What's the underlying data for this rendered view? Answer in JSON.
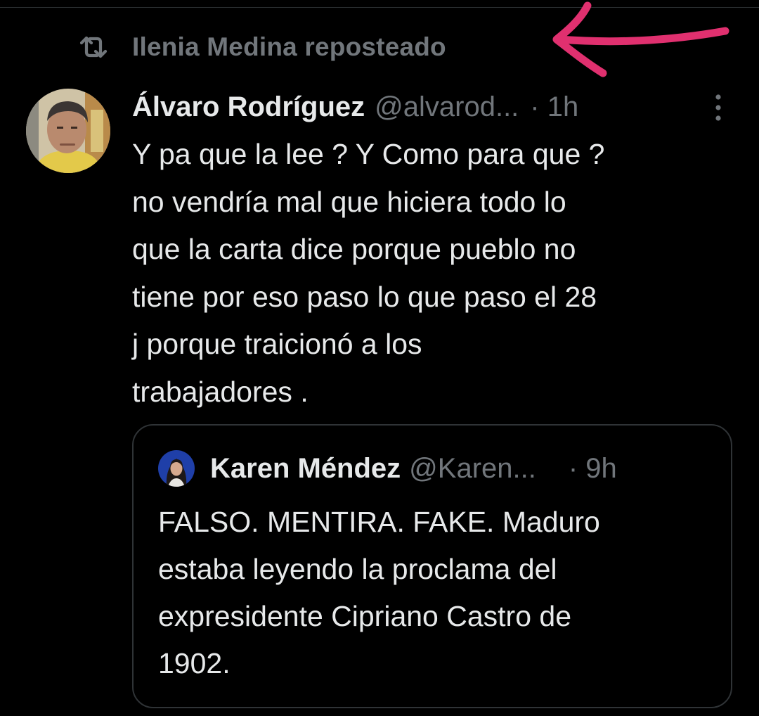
{
  "repost": {
    "icon": "repost-icon",
    "text": "Ilenia Medina reposteado"
  },
  "annotation": {
    "color": "#e0306f"
  },
  "tweet": {
    "author_name": "Álvaro Rodríguez",
    "author_handle": "@alvarod...",
    "time": "· 1h",
    "more_icon": "more-vertical-icon",
    "body_lines": [
      "Y pa que la lee ? Y Como para que ?",
      "no vendría mal que hiciera todo lo",
      "que la carta dice porque pueblo no",
      "tiene por eso paso lo que paso el 28",
      "j porque traicionó a los",
      "trabajadores ."
    ]
  },
  "quote": {
    "author_name": "Karen Méndez",
    "author_handle": "@Karen...",
    "time": "· 9h",
    "body_lines": [
      "FALSO. MENTIRA. FAKE. Maduro",
      "estaba leyendo la proclama del",
      "expresidente Cipriano Castro de",
      "1902."
    ]
  },
  "colors": {
    "background": "#000000",
    "primary_text": "#e7e9ea",
    "secondary_text": "#71767b",
    "border": "#2f3336"
  }
}
